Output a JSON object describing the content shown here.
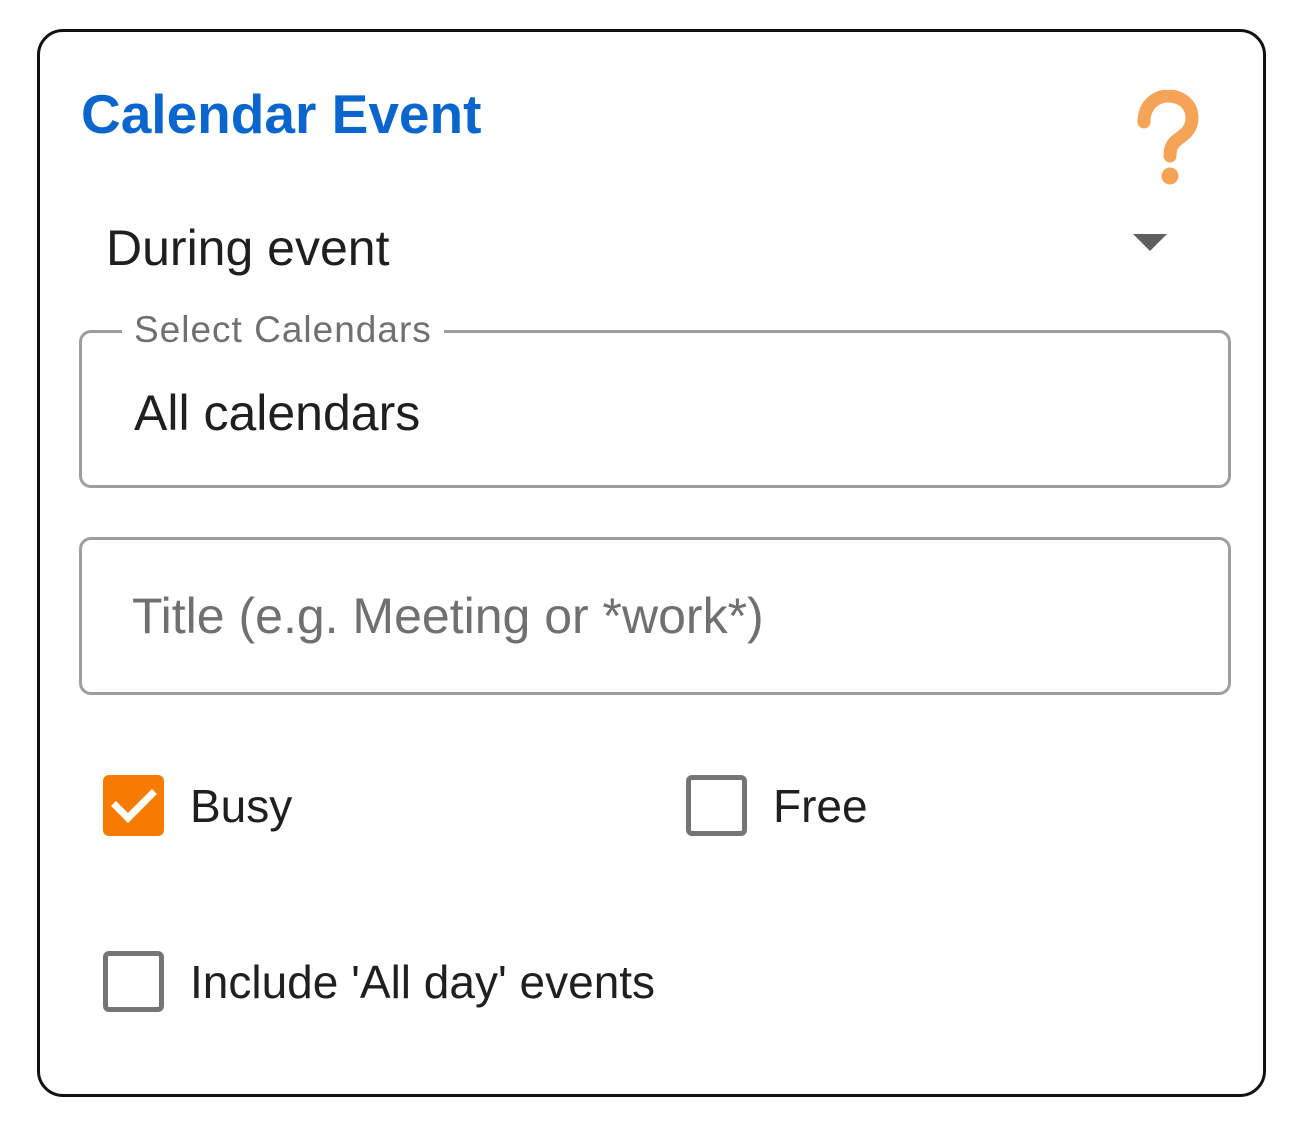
{
  "header": {
    "title": "Calendar Event",
    "help_icon": "question-mark-icon",
    "help_icon_color": "#f5a356"
  },
  "event_timing": {
    "selected": "During event"
  },
  "calendars_field": {
    "label": "Select Calendars",
    "value": "All calendars"
  },
  "title_field": {
    "value": "",
    "placeholder": "Title (e.g. Meeting or *work*)"
  },
  "availability": {
    "busy": {
      "label": "Busy",
      "checked": true
    },
    "free": {
      "label": "Free",
      "checked": false
    }
  },
  "all_day": {
    "label": "Include 'All day' events",
    "checked": false
  },
  "colors": {
    "title": "#0a66cc",
    "accent": "#f57c00",
    "border": "#9e9e9e",
    "card_border": "#111111"
  }
}
